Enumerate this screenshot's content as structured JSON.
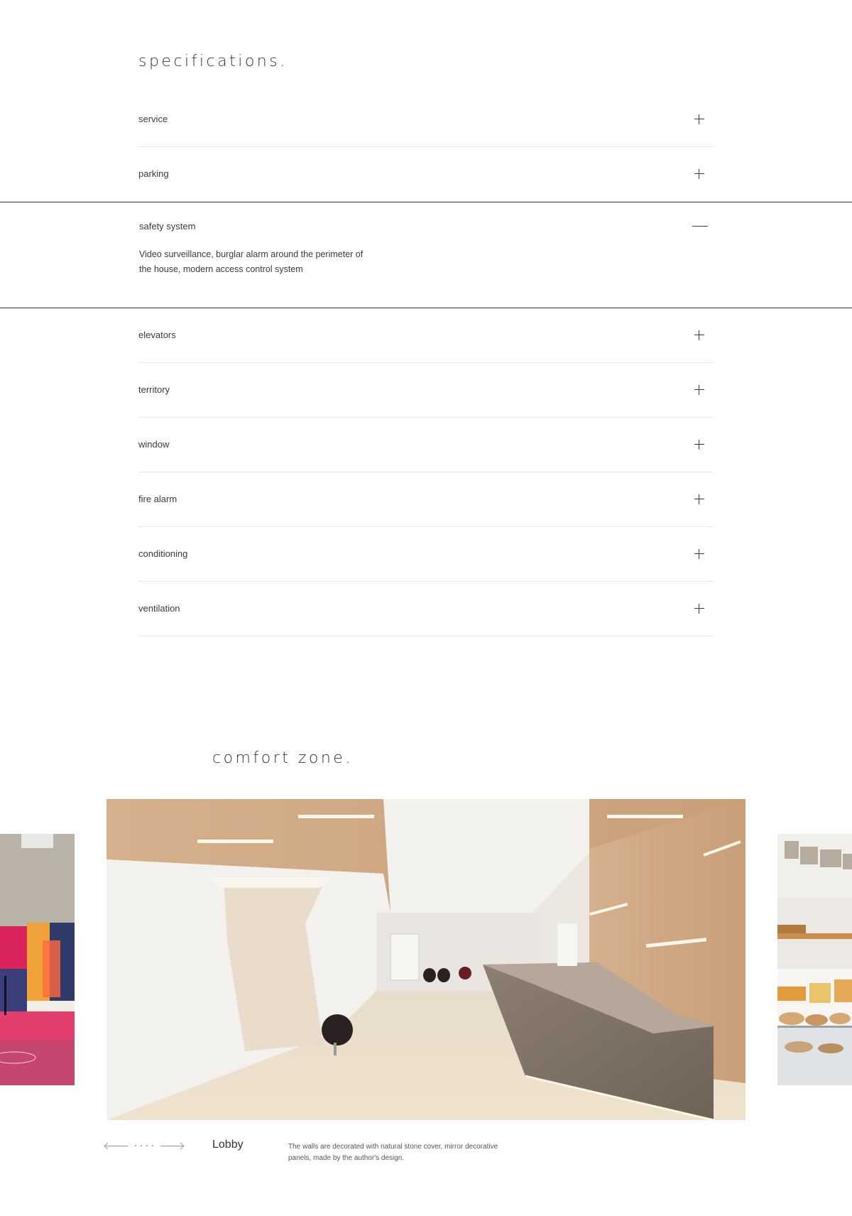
{
  "specifications": {
    "title": "specifications.",
    "items": [
      {
        "label": "service",
        "state": "collapsed"
      },
      {
        "label": "parking",
        "state": "collapsed"
      },
      {
        "label": "safety system",
        "state": "expanded",
        "description": "Video surveillance, burglar alarm around the perimeter of the house, modern access control system"
      },
      {
        "label": "elevators",
        "state": "collapsed"
      },
      {
        "label": "territory",
        "state": "collapsed"
      },
      {
        "label": "window",
        "state": "collapsed"
      },
      {
        "label": "fire alarm",
        "state": "collapsed"
      },
      {
        "label": "conditioning",
        "state": "collapsed"
      },
      {
        "label": "ventilation",
        "state": "collapsed"
      }
    ]
  },
  "comfort_zone": {
    "title": "comfort zone.",
    "current_slide": {
      "caption": "Lobby",
      "description": "The walls are decorated with natural stone cover, mirror decorative panels, made by the author's design."
    }
  },
  "colors": {
    "text": "#2b2b2b",
    "divider": "#e6e6e6",
    "accent_border": "#2f2f2f"
  }
}
